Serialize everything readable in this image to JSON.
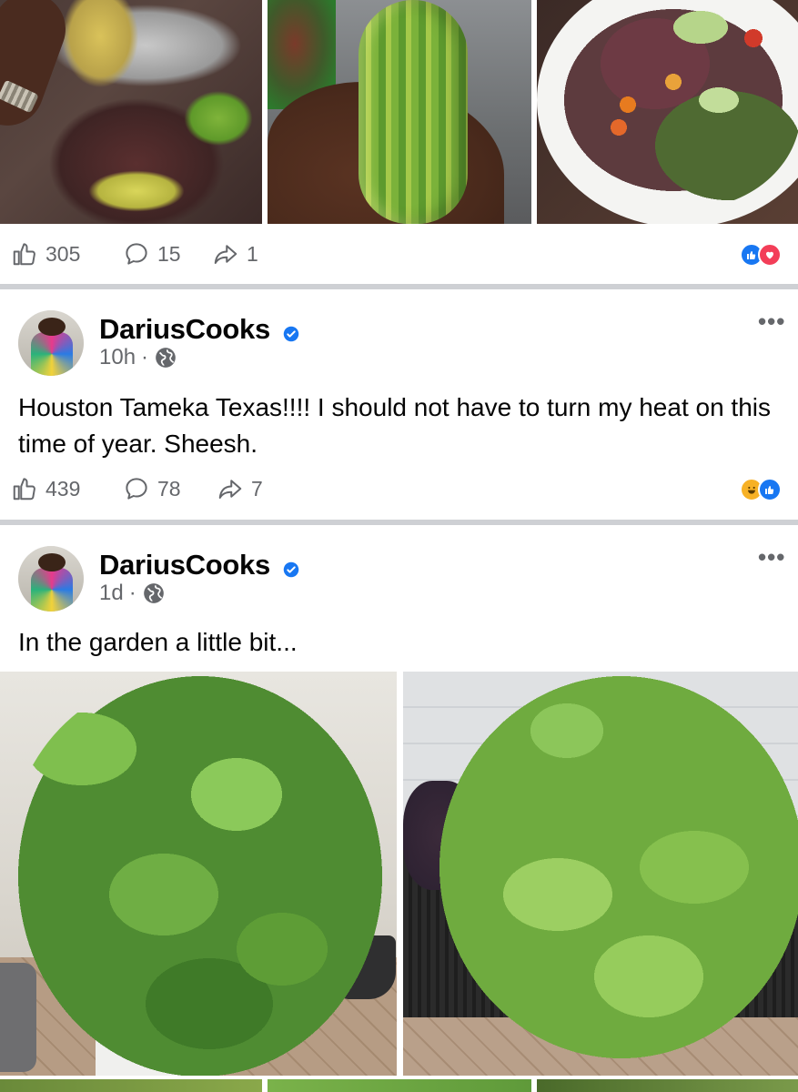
{
  "post1": {
    "photos": [
      "peppers-in-colander-photo",
      "cucumber-in-hand-photo",
      "salad-plate-photo"
    ],
    "likes": "305",
    "comments": "15",
    "shares": "1",
    "reactions": [
      "like",
      "love"
    ]
  },
  "post2": {
    "author": "DariusCooks",
    "time": "10h",
    "privacy_icon": "globe-icon",
    "text": "Houston Tameka Texas!!!! I should not have to turn my heat on this time of year. Sheesh.",
    "likes": "439",
    "comments": "78",
    "shares": "7",
    "reactions": [
      "haha",
      "like"
    ]
  },
  "post3": {
    "author": "DariusCooks",
    "time": "1d",
    "privacy_icon": "globe-icon",
    "text": "In the garden a little bit...",
    "photos": [
      "cucumber-plant-tower-photo",
      "cucumber-plant-planter-photo"
    ]
  },
  "colors": {
    "brand_blue": "#1877f2",
    "love_red": "#f33e58",
    "haha_yellow": "#f7b125",
    "secondary_text": "#65676b",
    "divider": "#ced0d4"
  }
}
